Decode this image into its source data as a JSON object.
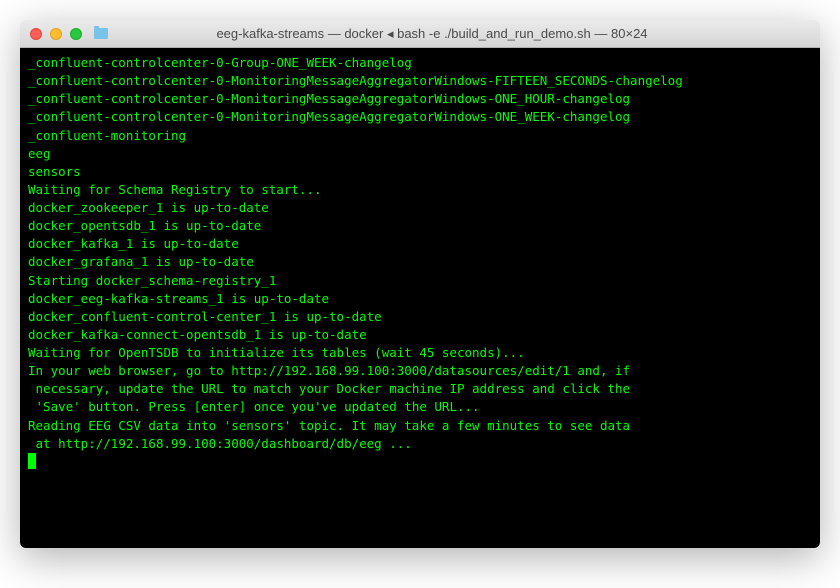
{
  "window": {
    "title": "eeg-kafka-streams — docker ◂ bash -e ./build_and_run_demo.sh — 80×24"
  },
  "terminal": {
    "lines": [
      "_confluent-controlcenter-0-Group-ONE_WEEK-changelog",
      "_confluent-controlcenter-0-MonitoringMessageAggregatorWindows-FIFTEEN_SECONDS-changelog",
      "_confluent-controlcenter-0-MonitoringMessageAggregatorWindows-ONE_HOUR-changelog",
      "_confluent-controlcenter-0-MonitoringMessageAggregatorWindows-ONE_WEEK-changelog",
      "_confluent-monitoring",
      "eeg",
      "sensors",
      "Waiting for Schema Registry to start...",
      "docker_zookeeper_1 is up-to-date",
      "docker_opentsdb_1 is up-to-date",
      "docker_kafka_1 is up-to-date",
      "docker_grafana_1 is up-to-date",
      "Starting docker_schema-registry_1",
      "docker_eeg-kafka-streams_1 is up-to-date",
      "docker_confluent-control-center_1 is up-to-date",
      "docker_kafka-connect-opentsdb_1 is up-to-date",
      "Waiting for OpenTSDB to initialize its tables (wait 45 seconds)...",
      "In your web browser, go to http://192.168.99.100:3000/datasources/edit/1 and, if",
      " necessary, update the URL to match your Docker machine IP address and click the",
      " 'Save' button. Press [enter] once you've updated the URL...",
      "Reading EEG CSV data into 'sensors' topic. It may take a few minutes to see data",
      " at http://192.168.99.100:3000/dashboard/db/eeg ..."
    ]
  }
}
